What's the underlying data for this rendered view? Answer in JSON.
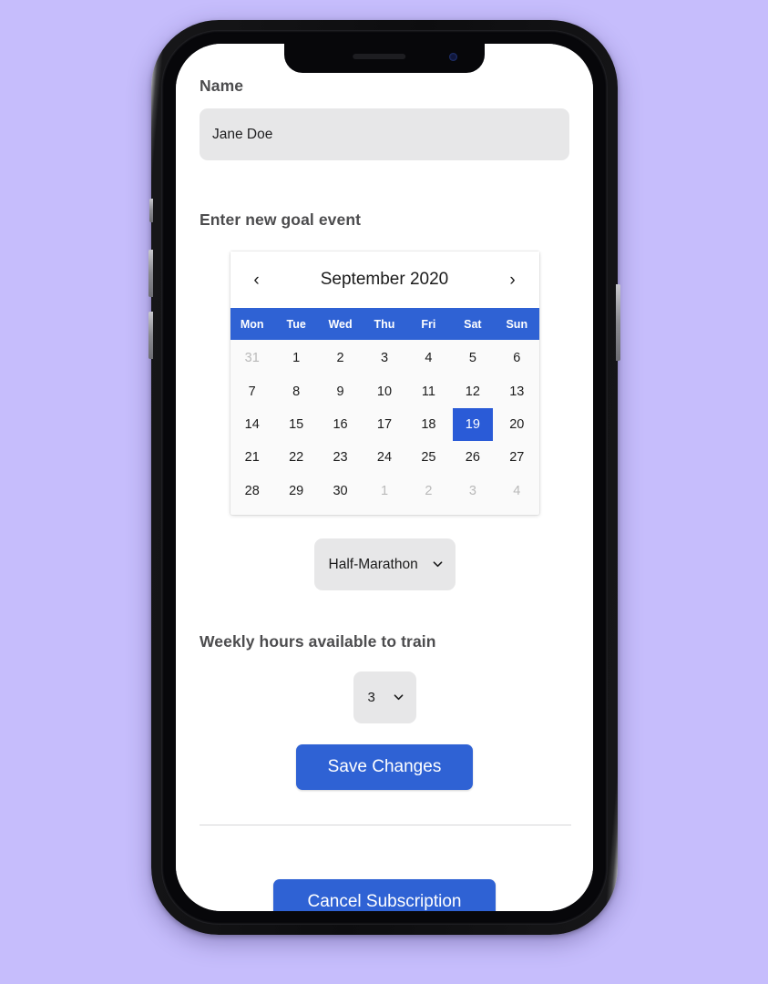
{
  "background_color": "#c6bdfc",
  "accent_color": "#2f62d4",
  "selected_day_color": "#2a5bd7",
  "input_background": "#e7e7e8",
  "form": {
    "name_label": "Name",
    "name_value": "Jane Doe",
    "name_placeholder": "Name",
    "goal_event_label": "Enter new goal event",
    "weekly_hours_label": "Weekly hours available to train"
  },
  "calendar": {
    "prev_icon": "‹",
    "next_icon": "›",
    "title": "September 2020",
    "weekdays": [
      "Mon",
      "Tue",
      "Wed",
      "Thu",
      "Fri",
      "Sat",
      "Sun"
    ],
    "selected_day": 19,
    "weeks": [
      [
        {
          "day": "31",
          "muted": true,
          "selected": false
        },
        {
          "day": "1",
          "muted": false,
          "selected": false
        },
        {
          "day": "2",
          "muted": false,
          "selected": false
        },
        {
          "day": "3",
          "muted": false,
          "selected": false
        },
        {
          "day": "4",
          "muted": false,
          "selected": false
        },
        {
          "day": "5",
          "muted": false,
          "selected": false
        },
        {
          "day": "6",
          "muted": false,
          "selected": false
        }
      ],
      [
        {
          "day": "7",
          "muted": false,
          "selected": false
        },
        {
          "day": "8",
          "muted": false,
          "selected": false
        },
        {
          "day": "9",
          "muted": false,
          "selected": false
        },
        {
          "day": "10",
          "muted": false,
          "selected": false
        },
        {
          "day": "11",
          "muted": false,
          "selected": false
        },
        {
          "day": "12",
          "muted": false,
          "selected": false
        },
        {
          "day": "13",
          "muted": false,
          "selected": false
        }
      ],
      [
        {
          "day": "14",
          "muted": false,
          "selected": false
        },
        {
          "day": "15",
          "muted": false,
          "selected": false
        },
        {
          "day": "16",
          "muted": false,
          "selected": false
        },
        {
          "day": "17",
          "muted": false,
          "selected": false
        },
        {
          "day": "18",
          "muted": false,
          "selected": false
        },
        {
          "day": "19",
          "muted": false,
          "selected": true
        },
        {
          "day": "20",
          "muted": false,
          "selected": false
        }
      ],
      [
        {
          "day": "21",
          "muted": false,
          "selected": false
        },
        {
          "day": "22",
          "muted": false,
          "selected": false
        },
        {
          "day": "23",
          "muted": false,
          "selected": false
        },
        {
          "day": "24",
          "muted": false,
          "selected": false
        },
        {
          "day": "25",
          "muted": false,
          "selected": false
        },
        {
          "day": "26",
          "muted": false,
          "selected": false
        },
        {
          "day": "27",
          "muted": false,
          "selected": false
        }
      ],
      [
        {
          "day": "28",
          "muted": false,
          "selected": false
        },
        {
          "day": "29",
          "muted": false,
          "selected": false
        },
        {
          "day": "30",
          "muted": false,
          "selected": false
        },
        {
          "day": "1",
          "muted": true,
          "selected": false
        },
        {
          "day": "2",
          "muted": true,
          "selected": false
        },
        {
          "day": "3",
          "muted": true,
          "selected": false
        },
        {
          "day": "4",
          "muted": true,
          "selected": false
        }
      ]
    ]
  },
  "event_type_select": {
    "selected": "Half-Marathon",
    "options": [
      "Half-Marathon"
    ],
    "icon": "chevron-down-icon"
  },
  "weekly_hours_select": {
    "selected": "3",
    "options": [
      "3"
    ],
    "icon": "chevron-down-icon"
  },
  "buttons": {
    "save_changes": "Save Changes",
    "cancel_subscription": "Cancel Subscription"
  }
}
